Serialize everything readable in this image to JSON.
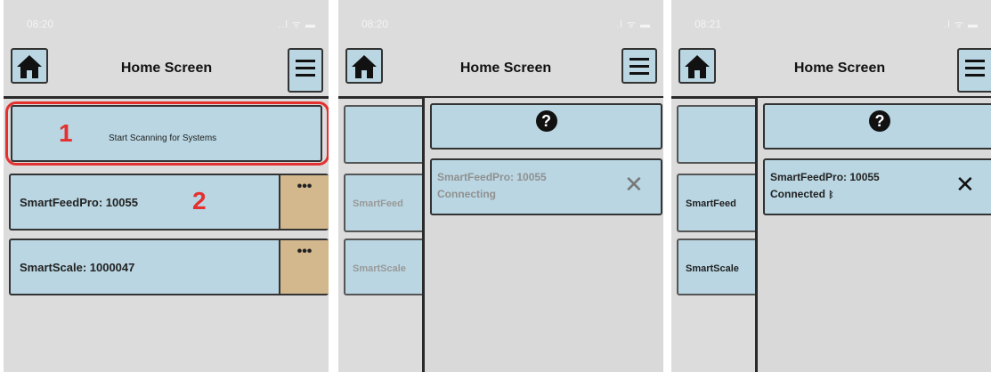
{
  "screens": [
    {
      "status": {
        "time": "08:20",
        "icons": "..l ᯤ ▬"
      },
      "header": {
        "title": "Home Screen",
        "home_icon": "home-icon",
        "menu_icon": "hamburger-icon"
      },
      "scan_button": {
        "label": "Start Scanning for Systems"
      },
      "annotations": {
        "one": "1",
        "two": "2"
      },
      "devices": [
        {
          "name": "SmartFeedPro: 10055",
          "more": "•••"
        },
        {
          "name": "SmartScale: 1000047",
          "more": "•••"
        }
      ]
    },
    {
      "status": {
        "time": "08:20",
        "icons": ".l ᯤ ▬"
      },
      "header": {
        "title": "Home Screen"
      },
      "behind": [
        {
          "name": "SmartFeed"
        },
        {
          "name": "SmartScale"
        }
      ],
      "panel": {
        "help_icon": "?",
        "device_name": "SmartFeedPro: 10055",
        "device_status": "Connecting",
        "close": "✕"
      }
    },
    {
      "status": {
        "time": "08:21",
        "icons": ".l ᯤ ▬"
      },
      "header": {
        "title": "Home Screen"
      },
      "behind": [
        {
          "name": "SmartFeed"
        },
        {
          "name": "SmartScale"
        }
      ],
      "panel": {
        "help_icon": "?",
        "device_name": "SmartFeedPro: 10055",
        "device_status": "Connected",
        "bt_icon": "ᛒ",
        "close": "✕"
      }
    }
  ],
  "colors": {
    "button_bg": "#b9d6e2",
    "more_bg": "#d3b78d",
    "annotation": "#e53030"
  }
}
